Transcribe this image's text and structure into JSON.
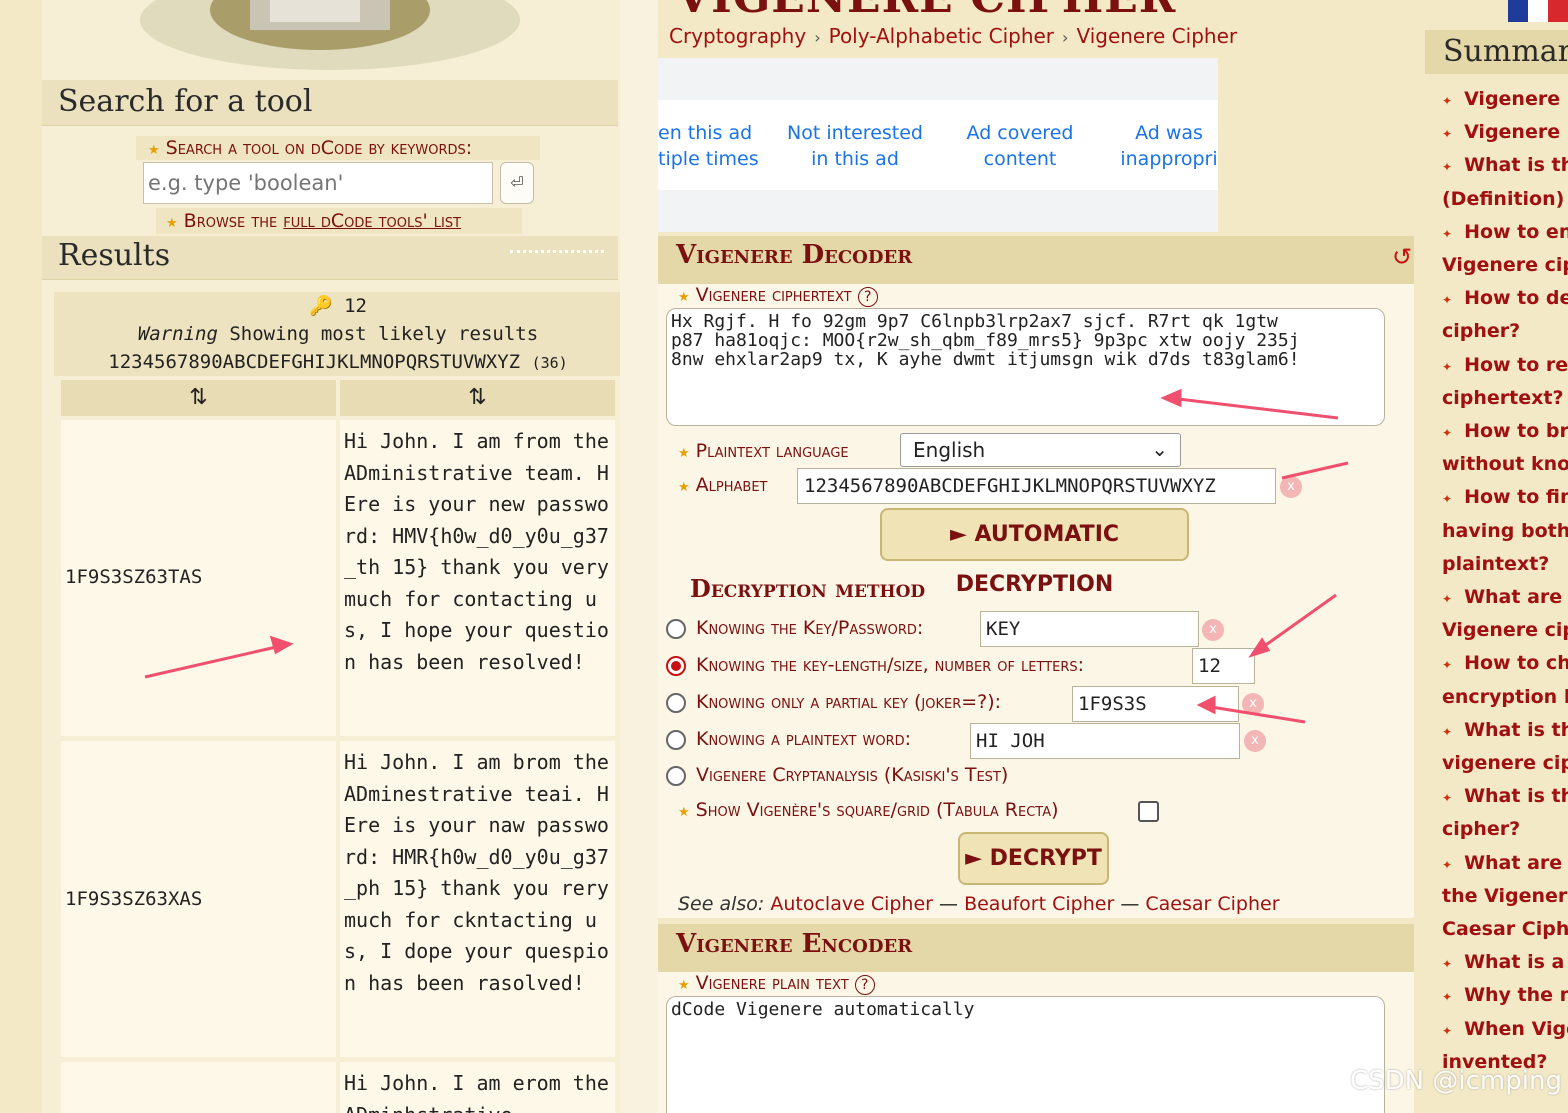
{
  "left": {
    "search_title": "Search for a tool",
    "search_label": "Search a tool on dCode by keywords:",
    "search_placeholder": "e.g. type 'boolean'",
    "search_button_icon": "return-key-icon",
    "browse_prefix": "Browse the ",
    "browse_link": "full dCode tools' list",
    "results_title": "Results",
    "results_count_icon": "key-icon",
    "results_count": "12",
    "warning_label": "Warning",
    "warning_text": " Showing most likely results",
    "alphabet_line": "1234567890ABCDEFGHIJKLMNOPQRSTUVWXYZ",
    "alphabet_count": "(36)",
    "col_sort_1": "⇅",
    "col_sort_2": "⇅",
    "rows": [
      {
        "key": "1F9S3SZ63TAS",
        "text": "Hi John. I am from the ADministrative team. HEre is your new password: HMV{h0w_d0_y0u_g37_th 15} thank you very much for contacting us, I hope your question has been resolved!"
      },
      {
        "key": "1F9S3SZ63XAS",
        "text": "Hi John. I am brom the ADminestrative teai. HEre is your naw password: HMR{h0w_d0_y0u_g37_ph 15} thank you rery much for ckntacting us, I dope your quespion has been rasolved!"
      },
      {
        "key": "",
        "text": "Hi John. I am erom the ADminhstrative"
      }
    ]
  },
  "middle": {
    "page_title": "VIGENERE CIPHER",
    "breadcrumbs": [
      "Cryptography",
      "Poly-Alphabetic Cipher",
      "Vigenere Cipher"
    ],
    "ad_options": [
      "en this ad\ntiple times",
      "Not interested\nin this ad",
      "Ad covered\ncontent",
      "Ad was\ninappropri"
    ],
    "decoder": {
      "title": "Vigenere Decoder",
      "reset_icon": "reset-icon",
      "ciphertext_label": "Vigenere ciphertext",
      "help_icon": "help-icon",
      "ciphertext": "Hx Rgjf. H fo 92gm 9p7 C6lnpb3lrp2ax7 sjcf. R7rt qk 1gtw\np87 ha81oqjc: MOO{r2w_sh_qbm_f89_mrs5} 9p3pc xtw oojy 235j\n8nw ehxlar2ap9 tx, K ayhe dwmt itjumsgn wik d7ds t83glam6!",
      "language_label": "Plaintext language",
      "language_value": "English",
      "alphabet_label": "Alphabet",
      "alphabet_value": "1234567890ABCDEFGHIJKLMNOPQRSTUVWXYZ",
      "auto_button": "► AUTOMATIC DECRYPTION",
      "method_title": "Decryption method",
      "methods": [
        {
          "label": "Knowing the Key/Password:",
          "value": "KEY",
          "selected": false
        },
        {
          "label": "Knowing the key-length/size, number of letters:",
          "value": "12",
          "selected": true
        },
        {
          "label": "Knowing only a partial key (joker=?):",
          "value": "1F9S3S",
          "selected": false
        },
        {
          "label": "Knowing a plaintext word:",
          "value": "HI JOH",
          "selected": false
        },
        {
          "label": "Vigenere Cryptanalysis (Kasiski's Test)",
          "value": "",
          "selected": false
        }
      ],
      "show_square_label": "Show Vigenère's square/grid (Tabula Recta)",
      "show_square_checked": false,
      "decrypt_button": "► DECRYPT",
      "see_also_label": "See also:",
      "see_also": [
        "Autoclave Cipher",
        "Beaufort Cipher",
        "Caesar Cipher"
      ],
      "see_also_sep": "—"
    },
    "encoder": {
      "title": "Vigenere Encoder",
      "plaintext_label": "Vigenere plain text",
      "plaintext": "dCode Vigenere automatically"
    }
  },
  "right": {
    "summary_title": "Summary",
    "toc": [
      {
        "bullet": true,
        "text": "Vigenere D"
      },
      {
        "bullet": true,
        "text": "Vigenere E"
      },
      {
        "bullet": true,
        "text": "What is the"
      },
      {
        "bullet": false,
        "text": "(Definition)"
      },
      {
        "bullet": true,
        "text": "How to enc"
      },
      {
        "bullet": false,
        "text": "Vigenere ciph"
      },
      {
        "bullet": true,
        "text": "How to dec"
      },
      {
        "bullet": false,
        "text": "cipher?"
      },
      {
        "bullet": true,
        "text": "How to reco"
      },
      {
        "bullet": false,
        "text": "ciphertext?"
      },
      {
        "bullet": true,
        "text": "How to bre"
      },
      {
        "bullet": false,
        "text": "without knowi"
      },
      {
        "bullet": true,
        "text": "How to find"
      },
      {
        "bullet": false,
        "text": "having both c"
      },
      {
        "bullet": false,
        "text": "plaintext?"
      },
      {
        "bullet": true,
        "text": "What are th"
      },
      {
        "bullet": false,
        "text": "Vigenere ciph"
      },
      {
        "bullet": true,
        "text": "How to cho"
      },
      {
        "bullet": false,
        "text": "encryption ke"
      },
      {
        "bullet": true,
        "text": "What is the"
      },
      {
        "bullet": false,
        "text": "vigenere ciphe"
      },
      {
        "bullet": true,
        "text": "What is the"
      },
      {
        "bullet": false,
        "text": "cipher?"
      },
      {
        "bullet": true,
        "text": "What are th"
      },
      {
        "bullet": false,
        "text": "the Vigenere c"
      },
      {
        "bullet": false,
        "text": "Caesar Ciphe"
      },
      {
        "bullet": true,
        "text": "What is a S"
      },
      {
        "bullet": true,
        "text": "Why the na"
      },
      {
        "bullet": true,
        "text": "When Vige"
      },
      {
        "bullet": false,
        "text": "invented?"
      }
    ],
    "flag_icon": "french-flag-icon"
  },
  "watermark": "CSDN @icmping",
  "colors": {
    "accent": "#7a1010",
    "link": "#a01010",
    "arrow": "#f0506e"
  }
}
